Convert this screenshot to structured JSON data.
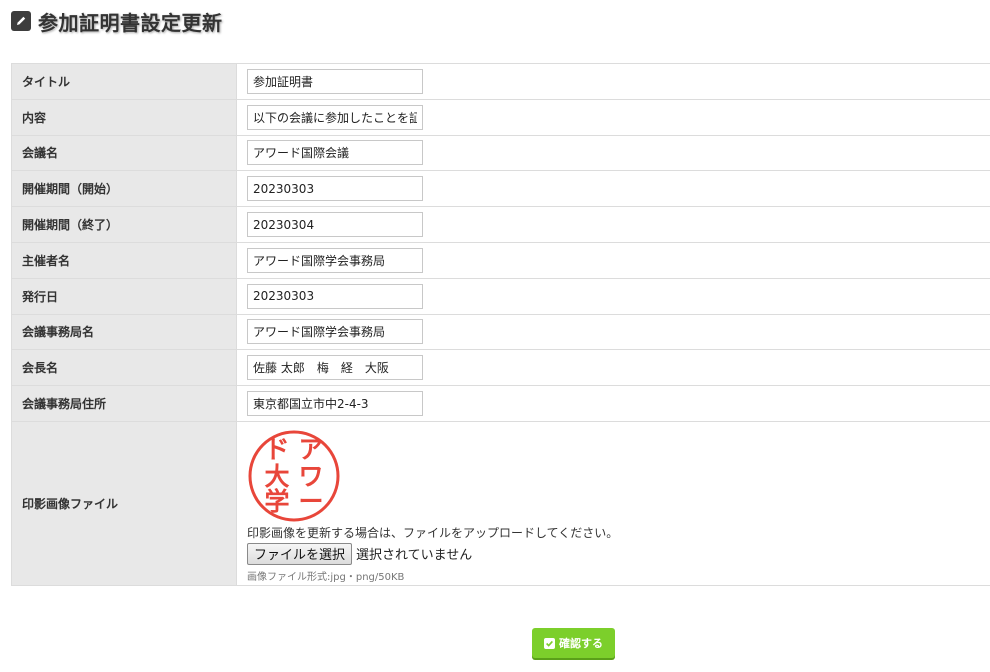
{
  "page": {
    "title": "参加証明書設定更新"
  },
  "fields": [
    {
      "label": "タイトル",
      "value": "参加証明書"
    },
    {
      "label": "内容",
      "value": "以下の会議に参加したことを証明します"
    },
    {
      "label": "会議名",
      "value": "アワード国際会議"
    },
    {
      "label": "開催期間（開始）",
      "value": "20230303"
    },
    {
      "label": "開催期間（終了）",
      "value": "20230304"
    },
    {
      "label": "主催者名",
      "value": "アワード国際学会事務局"
    },
    {
      "label": "発行日",
      "value": "20230303"
    },
    {
      "label": "会議事務局名",
      "value": "アワード国際学会事務局"
    },
    {
      "label": "会長名",
      "value": "佐藤 太郎　梅　経　大阪"
    },
    {
      "label": "会議事務局住所",
      "value": "東京都国立市中2-4-3"
    }
  ],
  "seal_image": {
    "label": "印影画像ファイル",
    "seal_text": "アワード大学",
    "upload_note": "印影画像を更新する場合は、ファイルをアップロードしてください。",
    "file_button_label": "ファイルを選択",
    "file_status": "選択されていません",
    "format_note": "画像ファイル形式:jpg・png/50KB",
    "seal_color": "#e8463a"
  },
  "actions": {
    "confirm_label": "確認する",
    "confirm_color": "#7ccf2b"
  }
}
